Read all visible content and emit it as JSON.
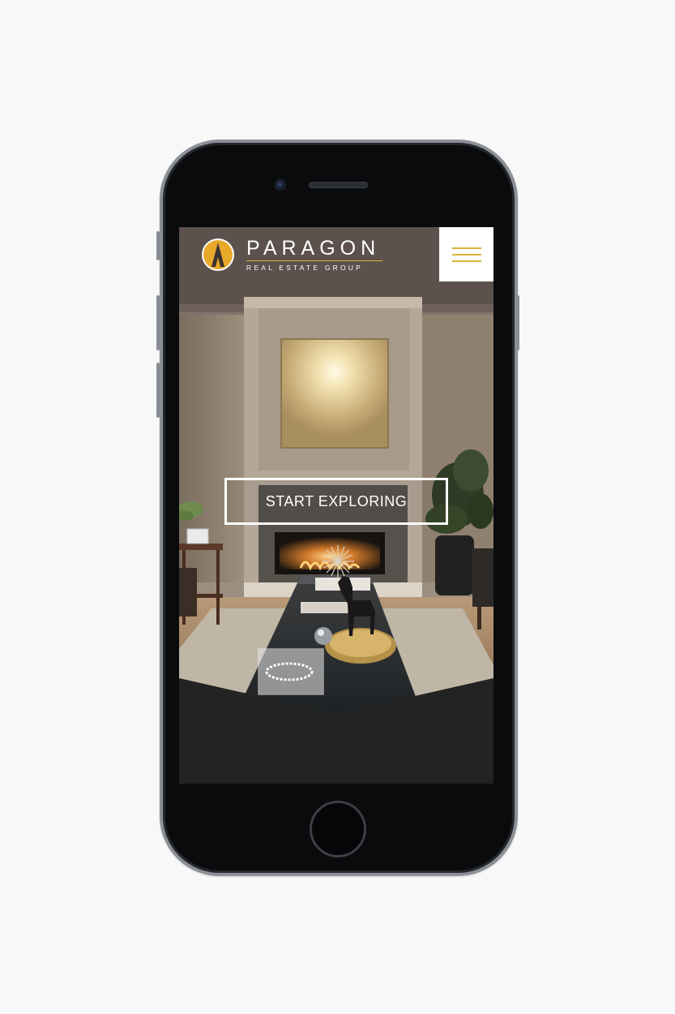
{
  "brand": {
    "name": "PARAGON",
    "tagline": "REAL ESTATE GROUP",
    "accent": "#d9b53a"
  },
  "header": {
    "menu_icon": "hamburger-menu-icon"
  },
  "hero": {
    "cta_label": "START EXPLORING"
  },
  "colors": {
    "page_bg": "#f8f8f8",
    "phone_frame": "#8b8f96",
    "phone_body": "#0a0b0d",
    "bottom_panel": "#232323"
  }
}
